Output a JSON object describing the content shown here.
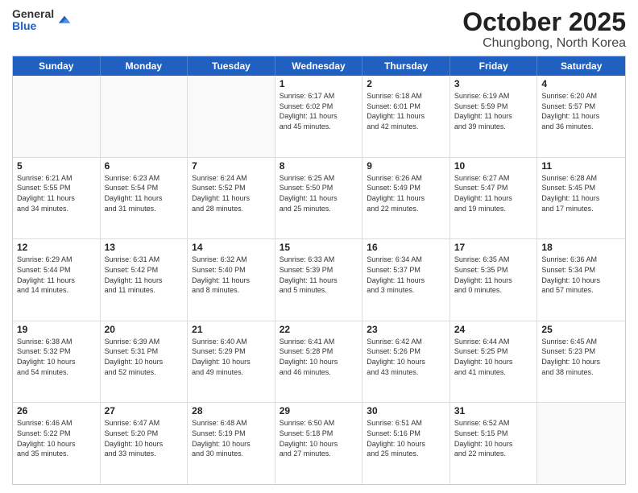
{
  "logo": {
    "general": "General",
    "blue": "Blue"
  },
  "title": {
    "month": "October 2025",
    "location": "Chungbong, North Korea"
  },
  "weekdays": [
    "Sunday",
    "Monday",
    "Tuesday",
    "Wednesday",
    "Thursday",
    "Friday",
    "Saturday"
  ],
  "weeks": [
    [
      {
        "day": "",
        "info": ""
      },
      {
        "day": "",
        "info": ""
      },
      {
        "day": "",
        "info": ""
      },
      {
        "day": "1",
        "info": "Sunrise: 6:17 AM\nSunset: 6:02 PM\nDaylight: 11 hours\nand 45 minutes."
      },
      {
        "day": "2",
        "info": "Sunrise: 6:18 AM\nSunset: 6:01 PM\nDaylight: 11 hours\nand 42 minutes."
      },
      {
        "day": "3",
        "info": "Sunrise: 6:19 AM\nSunset: 5:59 PM\nDaylight: 11 hours\nand 39 minutes."
      },
      {
        "day": "4",
        "info": "Sunrise: 6:20 AM\nSunset: 5:57 PM\nDaylight: 11 hours\nand 36 minutes."
      }
    ],
    [
      {
        "day": "5",
        "info": "Sunrise: 6:21 AM\nSunset: 5:55 PM\nDaylight: 11 hours\nand 34 minutes."
      },
      {
        "day": "6",
        "info": "Sunrise: 6:23 AM\nSunset: 5:54 PM\nDaylight: 11 hours\nand 31 minutes."
      },
      {
        "day": "7",
        "info": "Sunrise: 6:24 AM\nSunset: 5:52 PM\nDaylight: 11 hours\nand 28 minutes."
      },
      {
        "day": "8",
        "info": "Sunrise: 6:25 AM\nSunset: 5:50 PM\nDaylight: 11 hours\nand 25 minutes."
      },
      {
        "day": "9",
        "info": "Sunrise: 6:26 AM\nSunset: 5:49 PM\nDaylight: 11 hours\nand 22 minutes."
      },
      {
        "day": "10",
        "info": "Sunrise: 6:27 AM\nSunset: 5:47 PM\nDaylight: 11 hours\nand 19 minutes."
      },
      {
        "day": "11",
        "info": "Sunrise: 6:28 AM\nSunset: 5:45 PM\nDaylight: 11 hours\nand 17 minutes."
      }
    ],
    [
      {
        "day": "12",
        "info": "Sunrise: 6:29 AM\nSunset: 5:44 PM\nDaylight: 11 hours\nand 14 minutes."
      },
      {
        "day": "13",
        "info": "Sunrise: 6:31 AM\nSunset: 5:42 PM\nDaylight: 11 hours\nand 11 minutes."
      },
      {
        "day": "14",
        "info": "Sunrise: 6:32 AM\nSunset: 5:40 PM\nDaylight: 11 hours\nand 8 minutes."
      },
      {
        "day": "15",
        "info": "Sunrise: 6:33 AM\nSunset: 5:39 PM\nDaylight: 11 hours\nand 5 minutes."
      },
      {
        "day": "16",
        "info": "Sunrise: 6:34 AM\nSunset: 5:37 PM\nDaylight: 11 hours\nand 3 minutes."
      },
      {
        "day": "17",
        "info": "Sunrise: 6:35 AM\nSunset: 5:35 PM\nDaylight: 11 hours\nand 0 minutes."
      },
      {
        "day": "18",
        "info": "Sunrise: 6:36 AM\nSunset: 5:34 PM\nDaylight: 10 hours\nand 57 minutes."
      }
    ],
    [
      {
        "day": "19",
        "info": "Sunrise: 6:38 AM\nSunset: 5:32 PM\nDaylight: 10 hours\nand 54 minutes."
      },
      {
        "day": "20",
        "info": "Sunrise: 6:39 AM\nSunset: 5:31 PM\nDaylight: 10 hours\nand 52 minutes."
      },
      {
        "day": "21",
        "info": "Sunrise: 6:40 AM\nSunset: 5:29 PM\nDaylight: 10 hours\nand 49 minutes."
      },
      {
        "day": "22",
        "info": "Sunrise: 6:41 AM\nSunset: 5:28 PM\nDaylight: 10 hours\nand 46 minutes."
      },
      {
        "day": "23",
        "info": "Sunrise: 6:42 AM\nSunset: 5:26 PM\nDaylight: 10 hours\nand 43 minutes."
      },
      {
        "day": "24",
        "info": "Sunrise: 6:44 AM\nSunset: 5:25 PM\nDaylight: 10 hours\nand 41 minutes."
      },
      {
        "day": "25",
        "info": "Sunrise: 6:45 AM\nSunset: 5:23 PM\nDaylight: 10 hours\nand 38 minutes."
      }
    ],
    [
      {
        "day": "26",
        "info": "Sunrise: 6:46 AM\nSunset: 5:22 PM\nDaylight: 10 hours\nand 35 minutes."
      },
      {
        "day": "27",
        "info": "Sunrise: 6:47 AM\nSunset: 5:20 PM\nDaylight: 10 hours\nand 33 minutes."
      },
      {
        "day": "28",
        "info": "Sunrise: 6:48 AM\nSunset: 5:19 PM\nDaylight: 10 hours\nand 30 minutes."
      },
      {
        "day": "29",
        "info": "Sunrise: 6:50 AM\nSunset: 5:18 PM\nDaylight: 10 hours\nand 27 minutes."
      },
      {
        "day": "30",
        "info": "Sunrise: 6:51 AM\nSunset: 5:16 PM\nDaylight: 10 hours\nand 25 minutes."
      },
      {
        "day": "31",
        "info": "Sunrise: 6:52 AM\nSunset: 5:15 PM\nDaylight: 10 hours\nand 22 minutes."
      },
      {
        "day": "",
        "info": ""
      }
    ]
  ]
}
